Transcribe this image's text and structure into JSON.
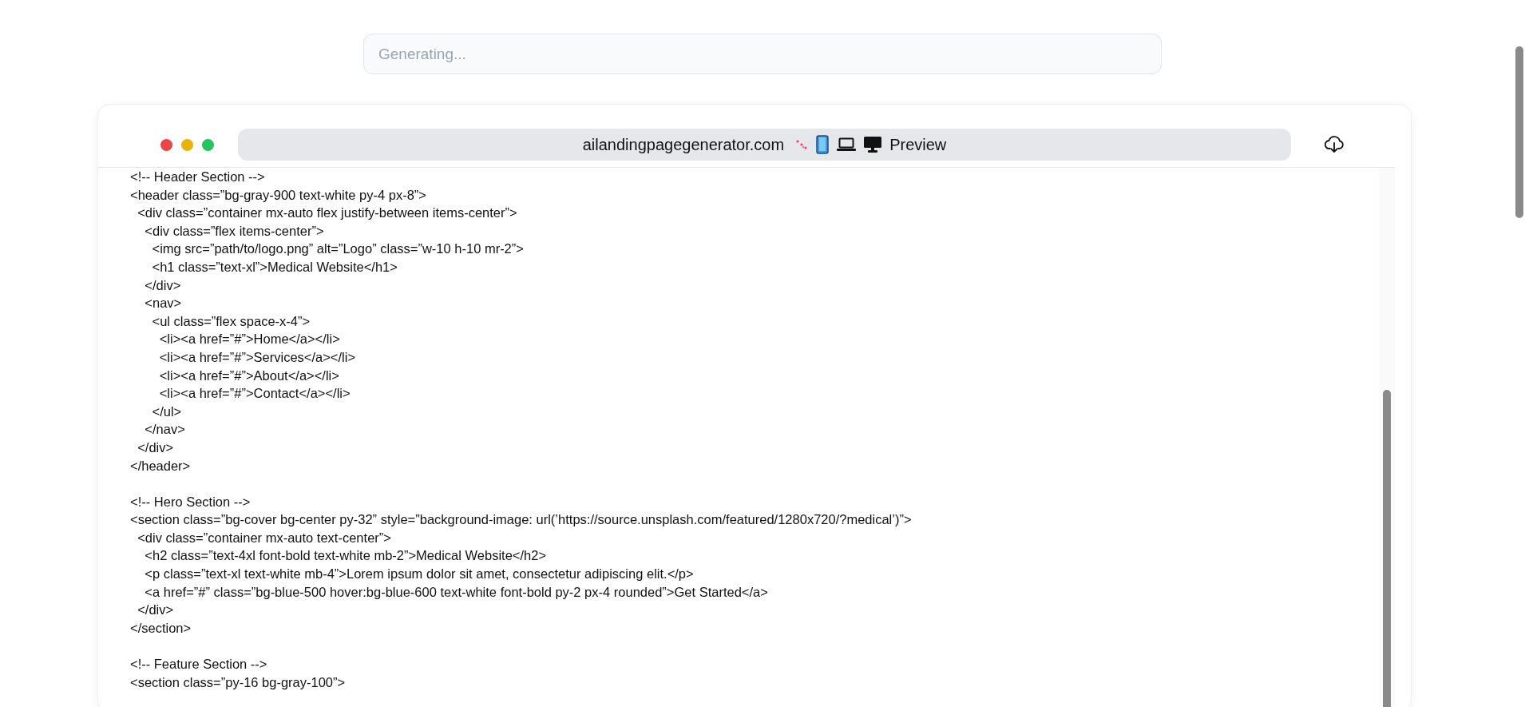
{
  "prompt_field": {
    "placeholder": "Generating..."
  },
  "browser_bar": {
    "address": "ailandingpagegenerator.com",
    "preview_label": "Preview"
  },
  "code_blocks": [
    {
      "lines": [
        "<!-- Header Section -->",
        "<header class=”bg-gray-900 text-white py-4 px-8”>",
        "  <div class=”container mx-auto flex justify-between items-center”>",
        "    <div class=”flex items-center”>",
        "      <img src=”path/to/logo.png” alt=”Logo” class=”w-10 h-10 mr-2”>",
        "      <h1 class=”text-xl”>Medical Website</h1>",
        "    </div>",
        "    <nav>",
        "      <ul class=”flex space-x-4”>",
        "        <li><a href=”#”>Home</a></li>",
        "        <li><a href=”#”>Services</a></li>",
        "        <li><a href=”#”>About</a></li>",
        "        <li><a href=”#”>Contact</a></li>",
        "      </ul>",
        "    </nav>",
        "  </div>",
        "</header>"
      ]
    },
    {
      "lines": [
        "<!-- Hero Section -->",
        "<section class=”bg-cover bg-center py-32” style=”background-image: url(’https://source.unsplash.com/featured/1280x720/?medical’)”>",
        "  <div class=”container mx-auto text-center”>",
        "    <h2 class=”text-4xl font-bold text-white mb-2”>Medical Website</h2>",
        "    <p class=”text-xl text-white mb-4”>Lorem ipsum dolor sit amet, consectetur adipiscing elit.</p>",
        "    <a href=”#” class=”bg-blue-500 hover:bg-blue-600 text-white font-bold py-2 px-4 rounded”>Get Started</a>",
        "  </div>",
        "</section>"
      ]
    },
    {
      "lines": [
        "<!-- Feature Section -->",
        "<section class=”py-16 bg-gray-100”>"
      ]
    }
  ]
}
